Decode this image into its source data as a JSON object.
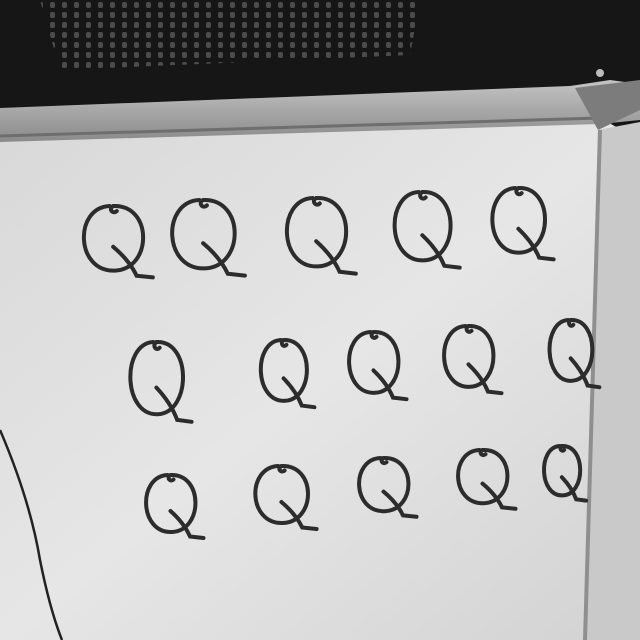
{
  "photo": {
    "colors": {
      "background": "#161616",
      "mesh_hole": "#5a5a5a",
      "frame_top": "#a9a9a9",
      "frame_shadow": "#6e6e6e",
      "board": "#e2e2e2",
      "board_shadow": "#cfcfcf",
      "ink": "#2c2c2c",
      "wire": "#222222"
    },
    "rows": [
      {
        "letters": [
          "Q",
          "Q",
          "Q",
          "Q",
          "Q"
        ]
      },
      {
        "letters": [
          "Q",
          "Q",
          "Q",
          "Q",
          "Q"
        ]
      },
      {
        "letters": [
          "Q",
          "Q",
          "Q",
          "Q",
          "Q"
        ]
      }
    ]
  }
}
